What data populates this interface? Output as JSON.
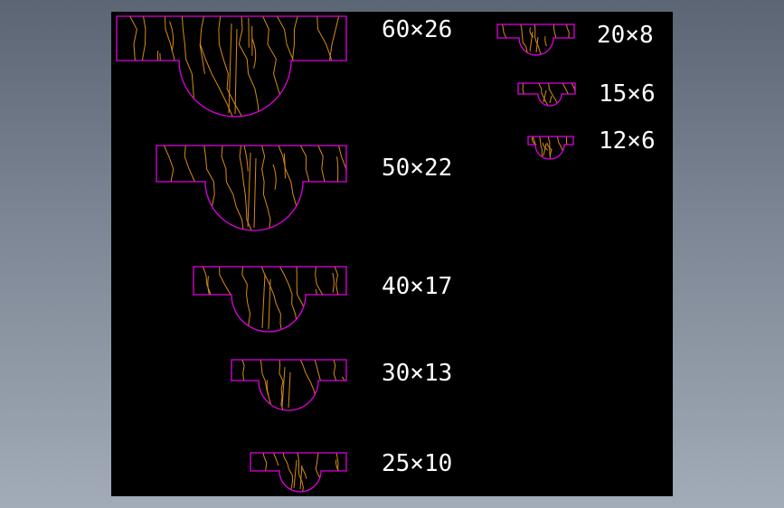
{
  "colors": {
    "background": "#000000",
    "outline": "#e000e0",
    "grain": "#d98c14",
    "text": "#ffffff"
  },
  "profiles": [
    {
      "name": "profile-60x26",
      "label": "60×26"
    },
    {
      "name": "profile-50x22",
      "label": "50×22"
    },
    {
      "name": "profile-40x17",
      "label": "40×17"
    },
    {
      "name": "profile-30x13",
      "label": "30×13"
    },
    {
      "name": "profile-25x10",
      "label": "25×10"
    },
    {
      "name": "profile-20x8",
      "label": "20×8"
    },
    {
      "name": "profile-15x6",
      "label": "15×6"
    },
    {
      "name": "profile-12x6",
      "label": "12×6"
    }
  ]
}
